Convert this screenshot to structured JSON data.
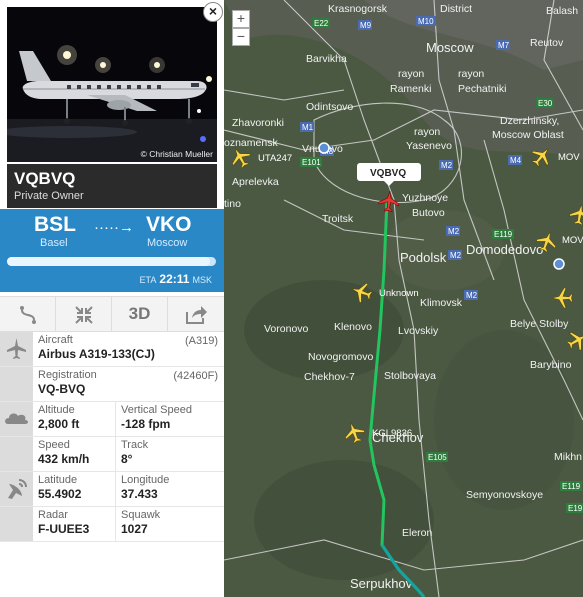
{
  "flight": {
    "callsign": "VQBVQ",
    "owner": "Private Owner",
    "photo_credit": "© Christian Mueller",
    "close_symbol": "×"
  },
  "route": {
    "from_code": "BSL",
    "from_city": "Basel",
    "to_code": "VKO",
    "to_city": "Moscow",
    "arrow": "·····→",
    "progress_fraction": 0.97,
    "eta_label": "ETA",
    "eta_time": "22:11",
    "eta_tz": "MSK"
  },
  "toolbar": {
    "route_icon": "route-icon",
    "fit_icon": "compress-icon",
    "view3d_label": "3D",
    "share_icon": "share-icon"
  },
  "details": {
    "aircraft_label": "Aircraft",
    "aircraft_value": "Airbus A319-133(CJ)",
    "aircraft_code": "(A319)",
    "registration_label": "Registration",
    "registration_value": "VQ-BVQ",
    "registration_code": "(42460F)",
    "altitude_label": "Altitude",
    "altitude_value": "2,800 ft",
    "vspeed_label": "Vertical Speed",
    "vspeed_value": "-128 fpm",
    "speed_label": "Speed",
    "speed_value": "432 km/h",
    "track_label": "Track",
    "track_value": "8°",
    "latitude_label": "Latitude",
    "latitude_value": "55.4902",
    "longitude_label": "Longitude",
    "longitude_value": "37.433",
    "radar_label": "Radar",
    "radar_value": "F-UUEE3",
    "squawk_label": "Squawk",
    "squawk_value": "1027"
  },
  "map": {
    "zoom_in": "+",
    "zoom_out": "−",
    "selected_flight": "VQBVQ",
    "places": {
      "krasnogorsk": "Krasnogorsk",
      "district": "District",
      "balash": "Balash",
      "moscow": "Moscow",
      "reutov": "Reutov",
      "barvikha": "Barvikha",
      "rayon": "rayon",
      "ramenki": "Ramenki",
      "pechatniki": "Pechatniki",
      "zhavoronki": "Zhavoronki",
      "odintsovo": "Odintsovo",
      "dzerzhinsky": "Dzerzhinsky,",
      "moscow_oblast": "Moscow Oblast",
      "oznamensk": "oznamensk",
      "vnukovo": "Vnukovo",
      "yasenevo": "Yasenevo",
      "aprelevka": "Aprelevka",
      "yuzhnoye": "Yuzhnoye",
      "butovo": "Butovo",
      "tino": "tino",
      "troitsk": "Troitsk",
      "podolsk": "Podolsk",
      "domodedovo": "Domodedovo",
      "klimovsk": "Klimovsk",
      "voronovo": "Voronovo",
      "klenovo": "Klenovo",
      "lvovskiy": "Lvovskiy",
      "belye_stolby": "Belye Stolby",
      "novogromovo": "Novogromovo",
      "chekhov7": "Chekhov-7",
      "stolbovaya": "Stolbovaya",
      "barybino": "Barybino",
      "chekhov": "Chekhov",
      "mikhn": "Mikhn",
      "semyonovskoye": "Semyonovskoye",
      "eleron": "Eleron",
      "serpukhov": "Serpukhov"
    },
    "flights": {
      "uta247": "UTA247",
      "unknown": "Unknown",
      "kgl9836": "KGL9836",
      "mov1": "MOV",
      "mov2": "MOV"
    },
    "roads": {
      "e22": "E22",
      "m9": "M9",
      "m10": "M10",
      "m7": "M7",
      "m1": "M1",
      "e30": "E30",
      "e101": "E101",
      "m3": "M3",
      "m4": "M4",
      "m2a": "M2",
      "m2b": "M2",
      "m2c": "M2",
      "m2d": "M2",
      "e119a": "E119",
      "e105": "E105",
      "e119b": "E119",
      "e19": "E19"
    }
  }
}
